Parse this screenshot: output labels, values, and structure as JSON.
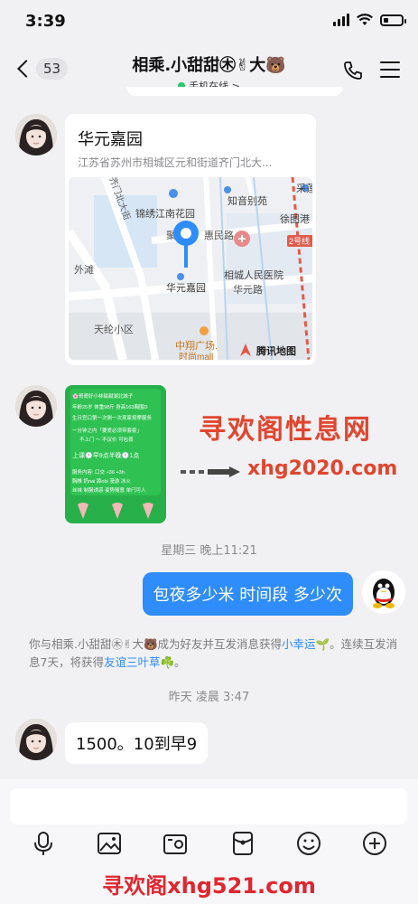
{
  "status_bar": {
    "time": "3:39",
    "battery_level": 0.25
  },
  "nav": {
    "back_count": "53",
    "title": "相乘.小甜甜㊍✌大🐻",
    "status": "手机在线 >"
  },
  "location_card": {
    "name": "华元嘉园",
    "address": "江苏省苏州市相城区元和街道齐门北大...",
    "map": {
      "labels": {
        "jinxiu": "锦绣江南花园",
        "zhiyin": "知音别苑",
        "xuyuangang": "徐图港",
        "caixian": "采莲",
        "qimen": "齐门北大街",
        "huimin": "惠民路",
        "yuanhe": "聚",
        "line2": "2号线",
        "waitan": "外滩",
        "hospital": "相城人民医院",
        "huayuan": "华元嘉园",
        "huayuanlu": "华元路",
        "tianlun": "天纶小区",
        "zhongxiang": "中翔广场.",
        "shidai": "时尚mall",
        "provider": "腾讯地图"
      }
    }
  },
  "image_message": {
    "lines": [
      "🌸哥哥好小林甜甜湖北妹子",
      "年龄25岁 体重98斤 身高163胸围D",
      "生日宫口第一次侧一次现家按摩服务",
      "一分钟之内「要爱必须带套套」",
      "不上门 ～ 不议价 可包夜",
      "上课🕐早9点半晚🕐1点",
      "服务内容: 口交 +36 +3h",
      "胸推 奶nai 舔obi 漫游 冰火",
      "丝袜 制服诱惑 姿势随意 单闩可人"
    ]
  },
  "watermark": {
    "site_name": "寻欢阁性息网",
    "site_url": "xhg2020.com",
    "footer": "寻欢阁xhg521.com"
  },
  "messages": {
    "time_1": "星期三 晚上11:21",
    "outgoing_1": "包夜多少米 时间段 多少次",
    "system_part1": "你与相乘.小甜甜㊍✌大🐻成为好友并互发消息获得",
    "system_link1": "小幸运",
    "system_part2": "🌱。连续互发消息7天，将获得",
    "system_link2": "友谊三叶草",
    "system_part3": "☘️。",
    "time_2": "昨天 凌晨 3:47",
    "incoming_1": "1500。10到早9"
  },
  "icons": {
    "back": "chevron-left-icon",
    "phone": "phone-icon",
    "menu": "menu-icon",
    "toolbar": [
      "microphone-icon",
      "image-icon",
      "camera-icon",
      "red-packet-icon",
      "emoji-icon",
      "plus-icon"
    ]
  },
  "colors": {
    "accent": "#2f8cfb",
    "online": "#28c76f",
    "watermark": "#e0462f"
  }
}
